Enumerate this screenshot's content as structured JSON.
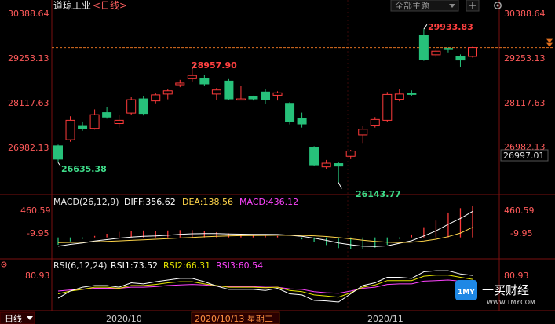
{
  "header": {
    "title": "道琼工业",
    "period": "<日线>",
    "theme_button": "全部主题",
    "add_icon": "plus-icon",
    "settings_icon": "gear-icon"
  },
  "colors": {
    "up": "#ff3b3b",
    "down": "#27c17a",
    "axis_text": "#ff5a5a",
    "grid": "#3a0000",
    "macd_diff": "#ffffff",
    "macd_dea": "#ffd54a",
    "rsi1": "#ffffff",
    "rsi2": "#e8e800",
    "rsi3": "#ff44ff"
  },
  "chart_data": {
    "type": "candlestick",
    "price_axis": {
      "ticks": [
        "30388.64",
        "29253.13",
        "28117.63",
        "26982.13"
      ],
      "ylim": [
        26000,
        30500
      ]
    },
    "current_price_label": "26997.01",
    "reference_level": 29480,
    "annotations": {
      "high": "29933.83",
      "mid_high": "28957.90",
      "low1": "26635.38",
      "low2": "26143.77"
    },
    "candles": [
      {
        "o": 27050,
        "h": 27080,
        "l": 26635,
        "c": 26720
      },
      {
        "o": 27200,
        "h": 27780,
        "l": 27150,
        "c": 27680
      },
      {
        "o": 27550,
        "h": 27650,
        "l": 27420,
        "c": 27480
      },
      {
        "o": 27480,
        "h": 27950,
        "l": 27450,
        "c": 27820
      },
      {
        "o": 27870,
        "h": 28010,
        "l": 27720,
        "c": 27760
      },
      {
        "o": 27600,
        "h": 27820,
        "l": 27500,
        "c": 27680
      },
      {
        "o": 27860,
        "h": 28250,
        "l": 27820,
        "c": 28190
      },
      {
        "o": 28210,
        "h": 28270,
        "l": 27800,
        "c": 27850
      },
      {
        "o": 28160,
        "h": 28360,
        "l": 28100,
        "c": 28310
      },
      {
        "o": 28330,
        "h": 28460,
        "l": 28200,
        "c": 28410
      },
      {
        "o": 28560,
        "h": 28680,
        "l": 28500,
        "c": 28600
      },
      {
        "o": 28710,
        "h": 28958,
        "l": 28640,
        "c": 28790
      },
      {
        "o": 28720,
        "h": 28810,
        "l": 28540,
        "c": 28580
      },
      {
        "o": 28330,
        "h": 28480,
        "l": 28180,
        "c": 28430
      },
      {
        "o": 28650,
        "h": 28700,
        "l": 28180,
        "c": 28210
      },
      {
        "o": 28210,
        "h": 28530,
        "l": 28180,
        "c": 28210
      },
      {
        "o": 28270,
        "h": 28290,
        "l": 28170,
        "c": 28210
      },
      {
        "o": 28380,
        "h": 28460,
        "l": 28090,
        "c": 28190
      },
      {
        "o": 28300,
        "h": 28400,
        "l": 28170,
        "c": 28360
      },
      {
        "o": 28100,
        "h": 28130,
        "l": 27580,
        "c": 27650
      },
      {
        "o": 27730,
        "h": 27870,
        "l": 27500,
        "c": 27590
      },
      {
        "o": 27000,
        "h": 27040,
        "l": 26560,
        "c": 26580
      },
      {
        "o": 26530,
        "h": 26700,
        "l": 26480,
        "c": 26620
      },
      {
        "o": 26610,
        "h": 26660,
        "l": 26144,
        "c": 26550
      },
      {
        "o": 26790,
        "h": 26950,
        "l": 26720,
        "c": 26920
      },
      {
        "o": 27320,
        "h": 27550,
        "l": 27120,
        "c": 27460
      },
      {
        "o": 27560,
        "h": 27760,
        "l": 27500,
        "c": 27700
      },
      {
        "o": 27680,
        "h": 28380,
        "l": 27640,
        "c": 28320
      },
      {
        "o": 28200,
        "h": 28460,
        "l": 28150,
        "c": 28330
      },
      {
        "o": 28350,
        "h": 28420,
        "l": 28270,
        "c": 28320
      },
      {
        "o": 29790,
        "h": 29934,
        "l": 29150,
        "c": 29180
      },
      {
        "o": 29300,
        "h": 29450,
        "l": 29240,
        "c": 29390
      },
      {
        "o": 29460,
        "h": 29480,
        "l": 29360,
        "c": 29440
      },
      {
        "o": 29250,
        "h": 29310,
        "l": 28990,
        "c": 29170
      },
      {
        "o": 29260,
        "h": 29500,
        "l": 29230,
        "c": 29480
      }
    ],
    "macd": {
      "label": "MACD(26,12,9)",
      "diff_label": "DIFF:356.62",
      "dea_label": "DEA:138.56",
      "macd_label": "MACD:436.12",
      "ticks": [
        "460.59",
        "-9.95"
      ],
      "ylim": [
        -250,
        500
      ],
      "diff": [
        -120,
        -95,
        -75,
        -50,
        -30,
        -10,
        5,
        15,
        20,
        30,
        42,
        50,
        52,
        52,
        48,
        45,
        43,
        42,
        40,
        30,
        15,
        -10,
        -40,
        -75,
        -100,
        -120,
        -125,
        -115,
        -80,
        -45,
        20,
        90,
        180,
        260,
        356
      ],
      "dea": [
        -70,
        -68,
        -65,
        -60,
        -55,
        -48,
        -40,
        -32,
        -25,
        -17,
        -8,
        0,
        8,
        15,
        20,
        24,
        26,
        28,
        30,
        30,
        28,
        22,
        12,
        -2,
        -20,
        -38,
        -55,
        -65,
        -70,
        -65,
        -50,
        -25,
        10,
        60,
        138
      ],
      "hist": [
        -100,
        -55,
        -20,
        20,
        50,
        75,
        90,
        95,
        90,
        95,
        100,
        100,
        88,
        72,
        55,
        42,
        34,
        28,
        20,
        0,
        -26,
        -64,
        -104,
        -146,
        -160,
        -164,
        -140,
        -100,
        -20,
        40,
        140,
        230,
        340,
        400,
        436
      ]
    },
    "rsi": {
      "label": "RSI(6,12,24)",
      "rsi1_label": "RSI1:73.52",
      "rsi2_label": "RSI2:66.31",
      "rsi3_label": "RSI3:60.54",
      "ticks": [
        "80.93"
      ],
      "ylim": [
        15,
        95
      ],
      "rsi1": [
        32,
        45,
        52,
        55,
        55,
        52,
        60,
        58,
        62,
        65,
        68,
        68,
        62,
        54,
        48,
        48,
        48,
        46,
        50,
        40,
        38,
        28,
        27,
        25,
        40,
        55,
        60,
        70,
        70,
        68,
        80,
        82,
        82,
        76,
        73.5
      ],
      "rsi2": [
        40,
        45,
        48,
        52,
        52,
        50,
        55,
        55,
        57,
        60,
        62,
        62,
        58,
        55,
        52,
        52,
        52,
        51,
        52,
        46,
        44,
        38,
        36,
        34,
        42,
        52,
        56,
        64,
        64,
        64,
        72,
        74,
        74,
        70,
        66.3
      ],
      "rsi3": [
        45,
        47,
        48,
        50,
        50,
        50,
        52,
        52,
        53,
        55,
        56,
        57,
        56,
        54,
        53,
        53,
        53,
        52,
        52,
        49,
        48,
        44,
        42,
        41,
        45,
        50,
        52,
        57,
        58,
        58,
        63,
        64,
        65,
        63,
        60.5
      ]
    },
    "x_labels": [
      "2020/10",
      "2020/11"
    ]
  },
  "footer": {
    "period_button": "日线",
    "cursor_date": "2020/10/13 星期二"
  },
  "watermark": {
    "text": "一买财经",
    "domain": "WWW.1MY.COM",
    "logo": "1MY"
  }
}
